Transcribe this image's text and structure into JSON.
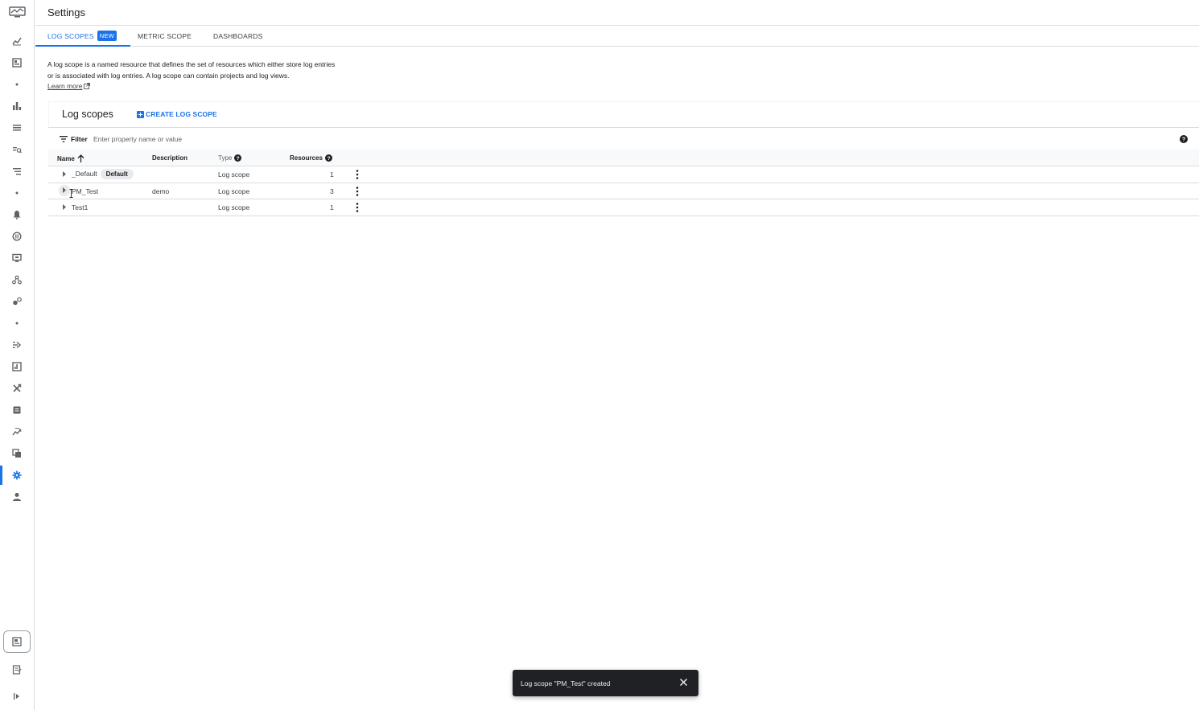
{
  "header": {
    "title": "Settings"
  },
  "tabs": [
    {
      "label": "LOG SCOPES",
      "badge": "NEW",
      "active": true
    },
    {
      "label": "METRIC SCOPE",
      "active": false
    },
    {
      "label": "DASHBOARDS",
      "active": false
    }
  ],
  "description": {
    "text": "A log scope is a named resource that defines the set of resources which either store log entries or is associated with log entries. A log scope can contain projects and log views.",
    "learn_more": "Learn more"
  },
  "card": {
    "title": "Log scopes",
    "create_button": "CREATE LOG SCOPE"
  },
  "filter": {
    "label": "Filter",
    "placeholder": "Enter property name or value"
  },
  "table": {
    "columns": [
      "Name",
      "Description",
      "Type",
      "Resources"
    ],
    "rows": [
      {
        "name": "_Default",
        "chip": "Default",
        "description": "",
        "type": "Log scope",
        "resources": "1"
      },
      {
        "name": "PM_Test",
        "chip": "",
        "description": "demo",
        "type": "Log scope",
        "resources": "3"
      },
      {
        "name": "Test1",
        "chip": "",
        "description": "",
        "type": "Log scope",
        "resources": "1"
      }
    ]
  },
  "snackbar": {
    "message": "Log scope \"PM_Test\" created"
  },
  "colors": {
    "accent": "#1a73e8",
    "snackbar_bg": "#202124",
    "rail_icon": "#5f6368"
  },
  "rail_icons": [
    "monitoring-logo-icon",
    "overview-chart-icon",
    "dashboards-icon",
    "separator-dot",
    "metrics-explorer-icon",
    "logs-explorer-icon",
    "log-analytics-icon",
    "log-router-icon",
    "separator-dot",
    "alerting-bell-icon",
    "uptime-checks-icon",
    "synthetic-monitor-icon",
    "service-topology-icon",
    "groups-icon",
    "separator-dot",
    "trace-explorer-icon",
    "profiler-icon",
    "integrations-icon",
    "error-reporting-icon",
    "slo-icon",
    "metrics-scope-icon",
    "settings-gear-icon",
    "account-person-icon",
    "cloud-shell-icon",
    "release-notes-icon",
    "expand-rail-icon"
  ]
}
